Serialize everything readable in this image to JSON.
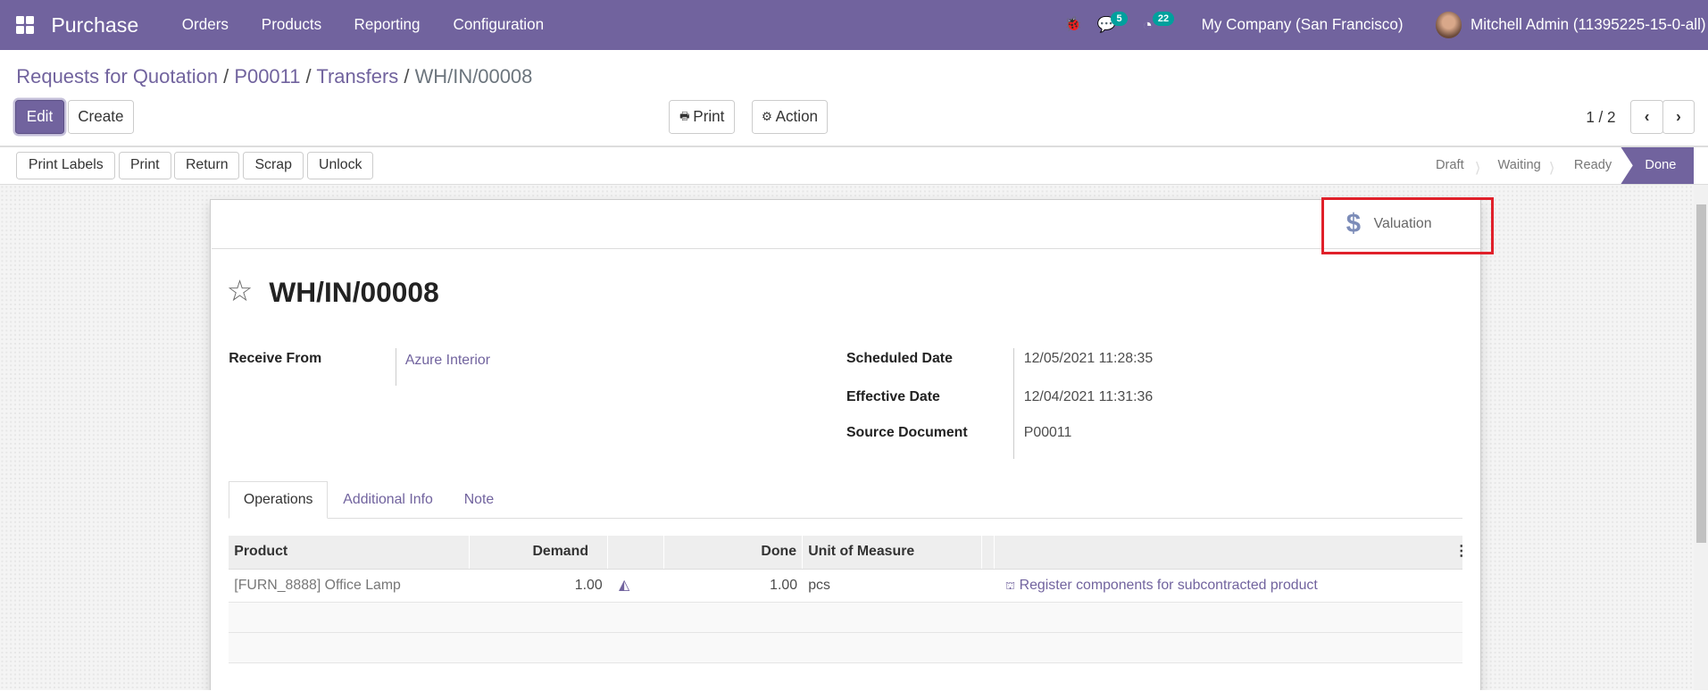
{
  "navbar": {
    "app": "Purchase",
    "menu": [
      "Orders",
      "Products",
      "Reporting",
      "Configuration"
    ],
    "messages_count": "5",
    "activities_count": "22",
    "company": "My Company (San Francisco)",
    "user": "Mitchell Admin (11395225-15-0-all)"
  },
  "breadcrumb": [
    "Requests for Quotation",
    "P00011",
    "Transfers",
    "WH/IN/00008"
  ],
  "control": {
    "edit": "Edit",
    "create": "Create",
    "print": "Print",
    "action": "Action",
    "pager": "1 / 2"
  },
  "header_buttons": [
    "Print Labels",
    "Print",
    "Return",
    "Scrap",
    "Unlock"
  ],
  "status": {
    "steps": [
      "Draft",
      "Waiting",
      "Ready",
      "Done"
    ],
    "current": "Done"
  },
  "button_box": {
    "valuation": "Valuation"
  },
  "record": {
    "title": "WH/IN/00008",
    "receive_from_label": "Receive From",
    "receive_from": "Azure Interior",
    "scheduled_label": "Scheduled Date",
    "scheduled": "12/05/2021 11:28:35",
    "effective_label": "Effective Date",
    "effective": "12/04/2021 11:31:36",
    "source_label": "Source Document",
    "source": "P00011"
  },
  "tabs": [
    "Operations",
    "Additional Info",
    "Note"
  ],
  "table": {
    "headers": [
      "Product",
      "Demand",
      "Done",
      "Unit of Measure"
    ],
    "rows": [
      {
        "product": "[FURN_8888] Office Lamp",
        "demand": "1.00",
        "done": "1.00",
        "uom": "pcs",
        "action": "Register components for subcontracted product"
      }
    ]
  },
  "colors": {
    "brand": "#71639e",
    "highlight": "#e0202a"
  }
}
